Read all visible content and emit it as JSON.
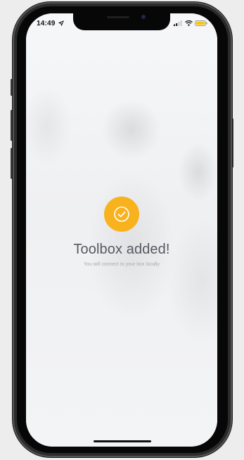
{
  "status_bar": {
    "time": "14:49",
    "icons": [
      "location-arrow-icon",
      "cellular-signal-icon",
      "wifi-icon",
      "battery-icon"
    ],
    "battery_color": "#f6c511"
  },
  "confirmation": {
    "icon": "checkmark-icon",
    "badge_color": "#f8b21e",
    "title": "Toolbox added!",
    "subtitle": "You will connect to your box locally"
  }
}
